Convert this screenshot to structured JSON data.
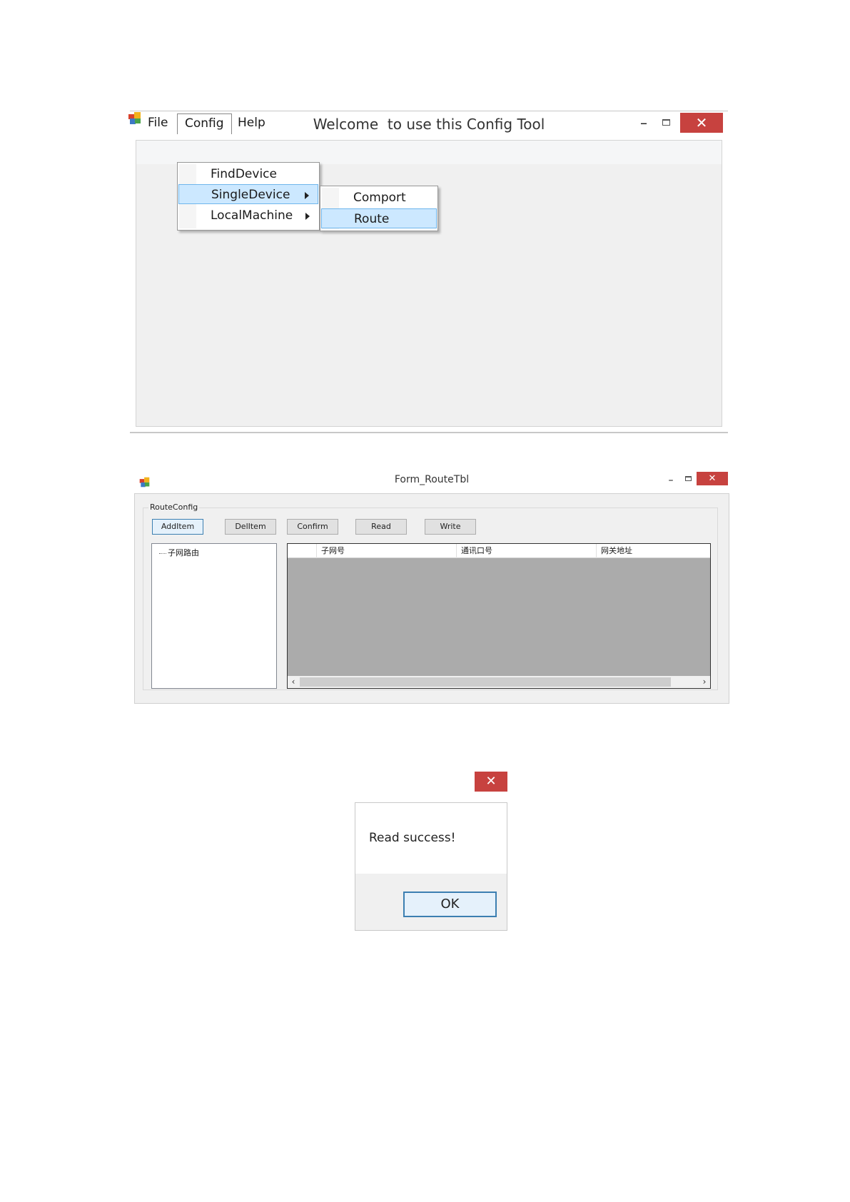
{
  "main_window": {
    "title": "Welcome  to use this Config Tool",
    "controls": {
      "minimize": "–",
      "close": "✕"
    },
    "menubar": {
      "file": "File",
      "config": "Config",
      "help": "Help"
    },
    "config_menu": [
      "FindDevice",
      "SingleDevice",
      "LocalMachine"
    ],
    "singledevice_submenu": [
      "Comport",
      "Route"
    ]
  },
  "route_window": {
    "title": "Form_RouteTbl",
    "controls": {
      "minimize": "–",
      "close": "✕"
    },
    "groupbox_label": "RouteConfig",
    "buttons": {
      "add": "AddItem",
      "del": "DelItem",
      "confirm": "Confirm",
      "read": "Read",
      "write": "Write"
    },
    "tree_node": "子网路由",
    "grid_columns": [
      "",
      "子网号",
      "通讯口号",
      "网关地址"
    ],
    "scroll": {
      "left": "‹",
      "right": "›"
    }
  },
  "dialog": {
    "close": "✕",
    "message": "Read success!",
    "ok": "OK"
  }
}
